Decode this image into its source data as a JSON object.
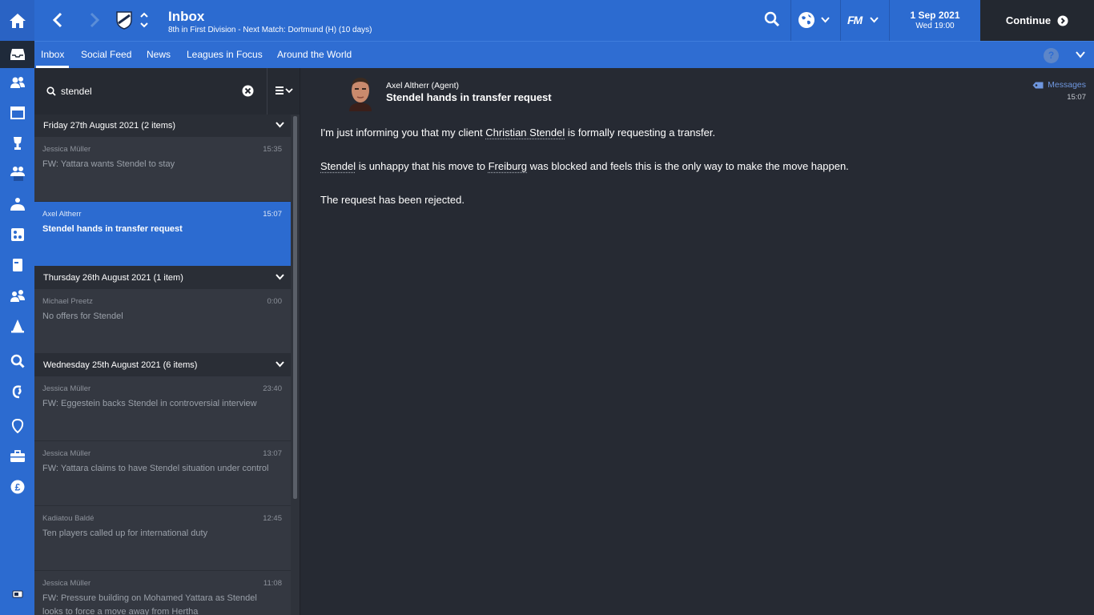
{
  "header": {
    "title": "Inbox",
    "subtitle": "8th in First Division - Next Match: Dortmund (H) (10 days)",
    "date": "1 Sep 2021",
    "time": "Wed 19:00",
    "continue_label": "Continue",
    "fm_logo": "FM"
  },
  "tabs": [
    {
      "label": "Inbox"
    },
    {
      "label": "Social Feed"
    },
    {
      "label": "News"
    },
    {
      "label": "Leagues in Focus"
    },
    {
      "label": "Around the World"
    }
  ],
  "help_label": "?",
  "search": {
    "value": "stendel"
  },
  "groups": [
    {
      "label": "Friday 27th August 2021 (2 items)"
    },
    {
      "label": "Thursday 26th August 2021 (1 item)"
    },
    {
      "label": "Wednesday 25th August 2021 (6 items)"
    }
  ],
  "messages": [
    {
      "sender": "Jessica Müller",
      "time": "15:35",
      "subject": "FW: Yattara wants Stendel to stay"
    },
    {
      "sender": "Axel Altherr",
      "time": "15:07",
      "subject": "Stendel hands in transfer request"
    },
    {
      "sender": "Michael Preetz",
      "time": "0:00",
      "subject": "No offers for Stendel"
    },
    {
      "sender": "Jessica Müller",
      "time": "23:40",
      "subject": "FW: Eggestein backs Stendel in controversial interview"
    },
    {
      "sender": "Jessica Müller",
      "time": "13:07",
      "subject": "FW: Yattara claims to have Stendel situation under control"
    },
    {
      "sender": "Kadiatou Baldé",
      "time": "12:45",
      "subject": "Ten players called up for international duty"
    },
    {
      "sender": "Jessica Müller",
      "time": "11:08",
      "subject": "FW: Pressure building on Mohamed  Yattara as Stendel looks to force a move away from Hertha"
    }
  ],
  "detail": {
    "from": "Axel Altherr  (Agent)",
    "title": "Stendel hands in transfer request",
    "messages_link": "Messages",
    "time": "15:07",
    "p1_a": "I'm just informing you that my client ",
    "p1_link": "Christian Stendel",
    "p1_b": " is formally requesting a transfer.",
    "p2_link1": "Stendel",
    "p2_a": " is unhappy that his move to ",
    "p2_link2": "Freiburg",
    "p2_b": " was blocked and feels this is the only way to make the move happen.",
    "p3": "The request has been rejected."
  },
  "colors": {
    "accent": "#2c6bd0",
    "dark": "#262a33",
    "continue_bg": "#232830"
  }
}
